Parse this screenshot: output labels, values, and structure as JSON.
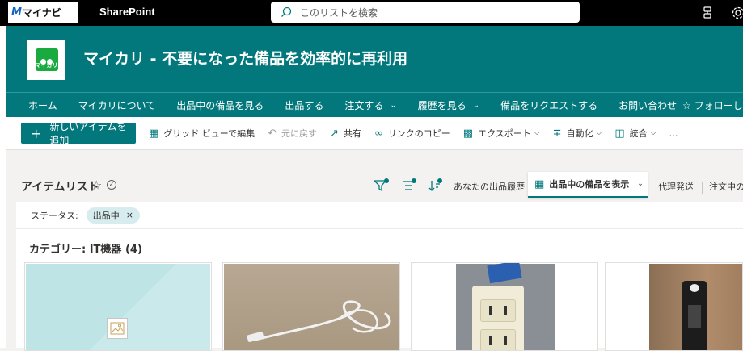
{
  "suitebar": {
    "brand_mark": "M",
    "brand_name": "マイナビ",
    "app_name": "SharePoint",
    "search_placeholder": "このリストを検索"
  },
  "site": {
    "logo_label": "マイカリ",
    "title": "マイカリ - 不要になった備品を効率的に再利用",
    "nav": [
      {
        "label": "ホーム"
      },
      {
        "label": "マイカリについて"
      },
      {
        "label": "出品中の備品を見る"
      },
      {
        "label": "出品する"
      },
      {
        "label": "注文する"
      },
      {
        "label": "履歴を見る"
      },
      {
        "label": "備品をリクエストする"
      },
      {
        "label": "お問い合わせ"
      }
    ],
    "follow_label": "フォローし"
  },
  "commandbar": {
    "new_item": "新しいアイテムを追加",
    "grid_edit": "グリッド ビューで編集",
    "undo": "元に戻す",
    "share": "共有",
    "copy_link": "リンクのコピー",
    "export": "エクスポート",
    "automate": "自動化",
    "integrate": "統合",
    "more": "…"
  },
  "list": {
    "title": "アイテムリスト",
    "views": {
      "your_history": "あなたの出品履歴",
      "active": "出品中の備品を表示",
      "proxy": "代理発送",
      "orders": "注文中の"
    }
  },
  "filter": {
    "label": "ステータス:",
    "pill": "出品中",
    "pill_remove": "×"
  },
  "group": {
    "label": "カテゴリー: IT機器 (4)"
  },
  "colors": {
    "theme": "#03787c",
    "suitebar": "#000000",
    "pill_bg": "#d7ecee"
  }
}
